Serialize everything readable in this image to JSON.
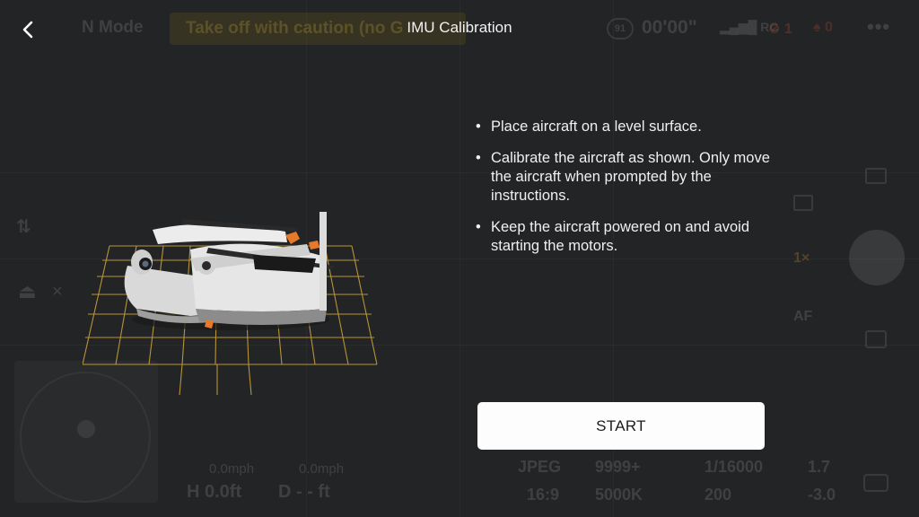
{
  "header": {
    "title": "IMU Calibration",
    "back_icon": "chevron-left-icon"
  },
  "instructions": [
    "Place aircraft on a level surface.",
    "Calibrate the aircraft as shown. Only move the aircraft when prompted by the instructions.",
    "Keep the aircraft powered on and avoid starting the motors."
  ],
  "start_button": {
    "label": "START"
  },
  "background_hud": {
    "flight_mode": "N Mode",
    "warning": "Take off with caution (no G",
    "timer": "00'00\"",
    "gps_badge": "91",
    "signal": "RC",
    "aircraft_battery": "1",
    "rc_battery": "0",
    "more": "•••",
    "speed_h": "0.0mph",
    "speed_v": "0.0mph",
    "height": "H 0.0ft",
    "distance": "D - - ft",
    "photo_format": "JPEG",
    "remaining": "9999+",
    "shutter": "1/16000",
    "aperture": "1.7",
    "aspect_ratio": "16:9",
    "white_balance": "5000K",
    "iso": "200",
    "ev": "-3.0",
    "zoom": "1×",
    "focus": "AF"
  },
  "colors": {
    "background": "#232425",
    "start_button_bg": "#fdfdfd",
    "grid": "#c9a13a",
    "accent_orange": "#e8792b"
  }
}
